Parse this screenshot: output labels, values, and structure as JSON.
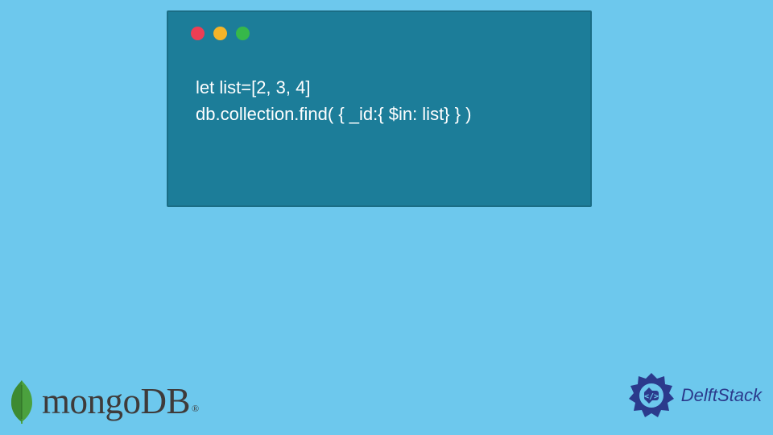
{
  "code": {
    "lines": [
      "let list=[2, 3, 4]",
      "db.collection.find( { _id:{ $in: list} } )"
    ]
  },
  "brands": {
    "mongodb": {
      "text": "mongoDB",
      "registered": "®"
    },
    "delftstack": {
      "text": "DelftStack"
    }
  },
  "colors": {
    "background": "#6dc8ed",
    "code_window": "#1c7d99",
    "traffic_red": "#ed3e54",
    "traffic_yellow": "#f5b428",
    "traffic_green": "#36b84a",
    "mongo_leaf": "#4ba13e",
    "delft_blue": "#2b3a8c"
  }
}
